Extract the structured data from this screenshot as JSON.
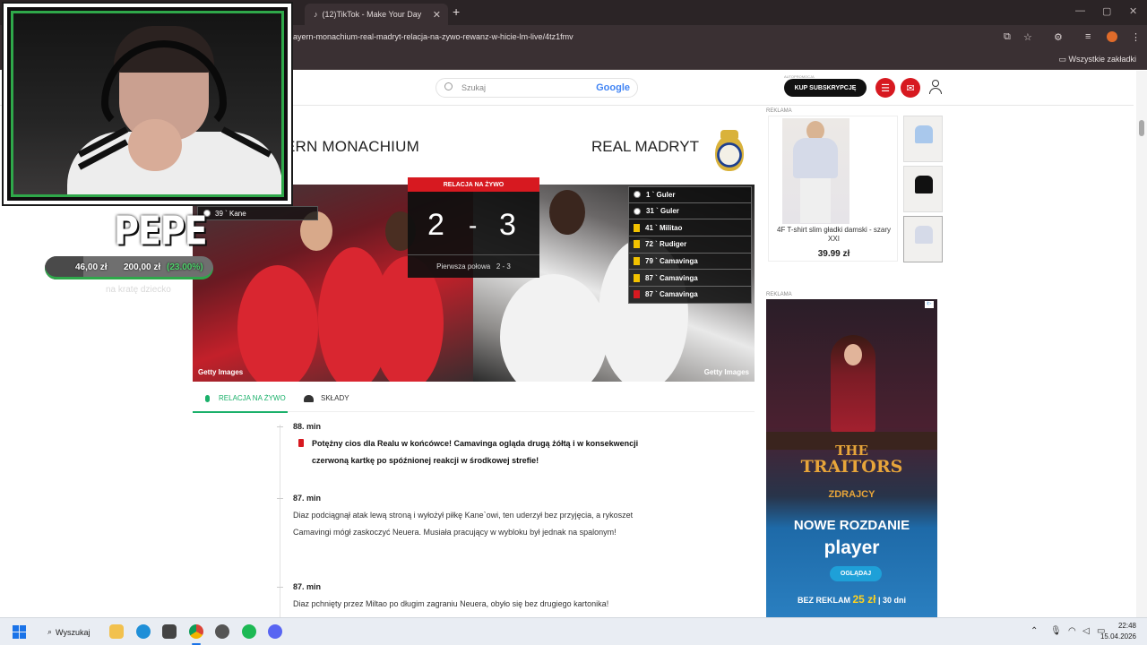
{
  "browser": {
    "active_tab_title": "(12)TikTok - Make Your Day",
    "url": "ayern-monachium-real-madryt-relacja-na-zywo-rewanz-w-hicie-lm-live/4tz1fmv",
    "bookmarks_folder": "Wszystkie zakładki"
  },
  "header": {
    "search_placeholder": "Szukaj",
    "search_brand": "Google",
    "subscription_note": "AUTOPROMOCJA",
    "subscribe_label": "KUP SUBSKRYPCJĘ"
  },
  "match": {
    "home_team": "ERN MONACHIUM",
    "away_team": "REAL MADRYT",
    "live_label": "RELACJA NA ŻYWO",
    "home_score": "2",
    "score_separator": "-",
    "away_score": "3",
    "half_label": "Pierwsza połowa",
    "half_score": "2 - 3",
    "home_scorer": "39 ` Kane",
    "photo_credit_left": "Getty Images",
    "photo_credit_right": "Getty Images",
    "events": [
      {
        "text": "1 ` Guler",
        "type": "goal"
      },
      {
        "text": "31 ` Guler",
        "type": "goal"
      },
      {
        "text": "41 ` Militao",
        "type": "yellow"
      },
      {
        "text": "72 ` Rudiger",
        "type": "yellow"
      },
      {
        "text": "79 ` Camavinga",
        "type": "yellow"
      },
      {
        "text": "87 ` Camavinga",
        "type": "yellow"
      },
      {
        "text": "87 ` Camavinga",
        "type": "red"
      }
    ]
  },
  "subtabs": {
    "live": "RELACJA NA ŻYWO",
    "squads": "SKŁADY"
  },
  "feed": [
    {
      "minute": "88. min",
      "text": "Potężny cios dla Realu w końcówce! Camavinga ogląda drugą żółtą i w konsekwencji czerwoną kartkę po spóźnionej reakcji w środkowej strefie!"
    },
    {
      "minute": "87. min",
      "text": "Diaz podciągnął atak lewą stroną i wyłożył piłkę Kane`owi, ten uderzył bez przyjęcia, a rykoszet Camavingi mógł zaskoczyć Neuera. Musiała pracujący w wybloku był jednak na spalonym!"
    },
    {
      "minute": "87. min",
      "text": "Diaz pchnięty przez Miltao po długim zagraniu Neuera, obyło się bez drugiego kartonika!"
    }
  ],
  "ads": {
    "label": "REKLAMA",
    "product_name": "4F T-shirt slim gładki damski - szary XXI",
    "product_price": "39.99 zł",
    "banner_ad_mark": "i▷",
    "banner_show_line1": "THE",
    "banner_show_line2": "TRAITORS",
    "banner_show_pl": "ZDRAJCY",
    "banner_title": "NOWE ROZDANIE",
    "banner_brand": "player",
    "banner_button": "OGLĄDAJ",
    "banner_foot_pre": "BEZ REKLAM",
    "banner_foot_price": "25 zł",
    "banner_foot_post": "| 30 dni"
  },
  "overlay": {
    "streamer_name": "PEPE",
    "donation_current": "46,00 zł",
    "donation_goal": "200,00 zł",
    "donation_percent": "(23.00%)",
    "donation_progress": 0.23,
    "donation_caption": "na kratę dziecko"
  },
  "taskbar": {
    "search_label": "Wyszukaj",
    "time": "22:48",
    "date": "15.04.2026"
  },
  "colors": {
    "accent_red": "#d71920",
    "live_green": "#1ab06a",
    "cam_border": "#2fa84a"
  }
}
